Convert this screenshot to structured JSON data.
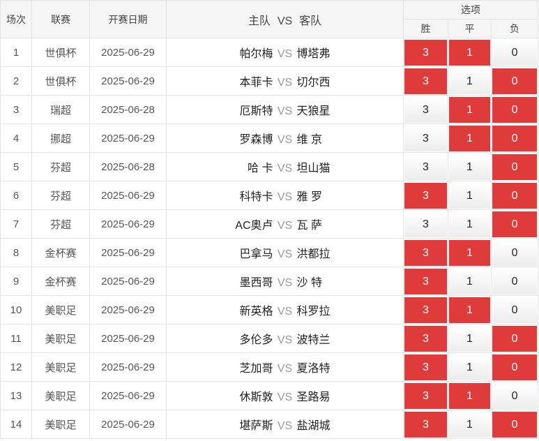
{
  "header": {
    "col_index": "场次",
    "col_league": "联赛",
    "col_date": "开赛日期",
    "col_home": "主队",
    "col_vs": "VS",
    "col_away": "客队",
    "col_options": "选项",
    "opt_win": "胜",
    "opt_draw": "平",
    "opt_loss": "负"
  },
  "colors": {
    "selected": "#e03b3b",
    "unselected": "#f2f2f2"
  },
  "rows": [
    {
      "idx": "1",
      "league": "世俱杯",
      "date": "2025-06-29",
      "home": "帕尔梅",
      "vs": "VS",
      "away": "博塔弗",
      "win": "3",
      "draw": "1",
      "loss": "0",
      "win_sel": true,
      "draw_sel": true,
      "loss_sel": false
    },
    {
      "idx": "2",
      "league": "世俱杯",
      "date": "2025-06-29",
      "home": "本菲卡",
      "vs": "VS",
      "away": "切尔西",
      "win": "3",
      "draw": "1",
      "loss": "0",
      "win_sel": true,
      "draw_sel": false,
      "loss_sel": true
    },
    {
      "idx": "3",
      "league": "瑞超",
      "date": "2025-06-28",
      "home": "厄斯特",
      "vs": "VS",
      "away": "天狼星",
      "win": "3",
      "draw": "1",
      "loss": "0",
      "win_sel": false,
      "draw_sel": true,
      "loss_sel": true
    },
    {
      "idx": "4",
      "league": "挪超",
      "date": "2025-06-29",
      "home": "罗森博",
      "vs": "VS",
      "away": "维 京",
      "win": "3",
      "draw": "1",
      "loss": "0",
      "win_sel": false,
      "draw_sel": true,
      "loss_sel": true
    },
    {
      "idx": "5",
      "league": "芬超",
      "date": "2025-06-28",
      "home": "哈 卡",
      "vs": "VS",
      "away": "坦山猫",
      "win": "3",
      "draw": "1",
      "loss": "0",
      "win_sel": false,
      "draw_sel": false,
      "loss_sel": true
    },
    {
      "idx": "6",
      "league": "芬超",
      "date": "2025-06-29",
      "home": "科特卡",
      "vs": "VS",
      "away": "雅 罗",
      "win": "3",
      "draw": "1",
      "loss": "0",
      "win_sel": true,
      "draw_sel": false,
      "loss_sel": true
    },
    {
      "idx": "7",
      "league": "芬超",
      "date": "2025-06-29",
      "home": "AC奥卢",
      "vs": "VS",
      "away": "瓦 萨",
      "win": "3",
      "draw": "1",
      "loss": "0",
      "win_sel": false,
      "draw_sel": false,
      "loss_sel": true
    },
    {
      "idx": "8",
      "league": "金杯赛",
      "date": "2025-06-29",
      "home": "巴拿马",
      "vs": "VS",
      "away": "洪都拉",
      "win": "3",
      "draw": "1",
      "loss": "0",
      "win_sel": true,
      "draw_sel": true,
      "loss_sel": false
    },
    {
      "idx": "9",
      "league": "金杯赛",
      "date": "2025-06-29",
      "home": "墨西哥",
      "vs": "VS",
      "away": "沙 特",
      "win": "3",
      "draw": "1",
      "loss": "0",
      "win_sel": true,
      "draw_sel": false,
      "loss_sel": false
    },
    {
      "idx": "10",
      "league": "美职足",
      "date": "2025-06-29",
      "home": "新英格",
      "vs": "VS",
      "away": "科罗拉",
      "win": "3",
      "draw": "1",
      "loss": "0",
      "win_sel": true,
      "draw_sel": true,
      "loss_sel": false
    },
    {
      "idx": "11",
      "league": "美职足",
      "date": "2025-06-29",
      "home": "多伦多",
      "vs": "VS",
      "away": "波特兰",
      "win": "3",
      "draw": "1",
      "loss": "0",
      "win_sel": true,
      "draw_sel": false,
      "loss_sel": true
    },
    {
      "idx": "12",
      "league": "美职足",
      "date": "2025-06-29",
      "home": "芝加哥",
      "vs": "VS",
      "away": "夏洛特",
      "win": "3",
      "draw": "1",
      "loss": "0",
      "win_sel": true,
      "draw_sel": false,
      "loss_sel": true
    },
    {
      "idx": "13",
      "league": "美职足",
      "date": "2025-06-29",
      "home": "休斯敦",
      "vs": "VS",
      "away": "圣路易",
      "win": "3",
      "draw": "1",
      "loss": "0",
      "win_sel": true,
      "draw_sel": true,
      "loss_sel": false
    },
    {
      "idx": "14",
      "league": "美职足",
      "date": "2025-06-29",
      "home": "堪萨斯",
      "vs": "VS",
      "away": "盐湖城",
      "win": "3",
      "draw": "1",
      "loss": "0",
      "win_sel": true,
      "draw_sel": false,
      "loss_sel": true
    }
  ]
}
